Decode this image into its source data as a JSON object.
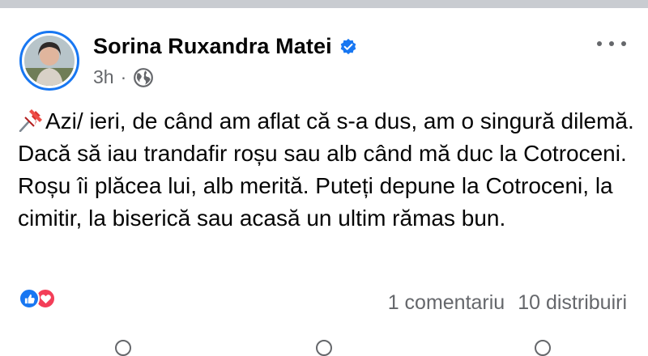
{
  "post": {
    "author": "Sorina Ruxandra Matei",
    "verified_icon": "verified-badge-icon",
    "time": "3h",
    "separator": "·",
    "audience_icon": "globe-icon",
    "more_icon": "more-options-icon",
    "text_icon": "pushpin-icon",
    "text": "Azi/ ieri, de când am aflat că s-a dus, am o singură dilemă. Dacă să iau trandafir roșu sau alb când mă duc la Cotroceni. Roșu îi plăcea lui, alb merită. Puteți depune la Cotroceni, la cimitir, la biserică sau acasă un ultim rămas bun.",
    "reactions": [
      "like-reaction-icon",
      "love-reaction-icon"
    ],
    "comments": "1 comentariu",
    "shares": "10 distribuiri"
  },
  "colors": {
    "accent": "#1877f2",
    "love": "#f33e58",
    "secondary_text": "#65676b"
  }
}
